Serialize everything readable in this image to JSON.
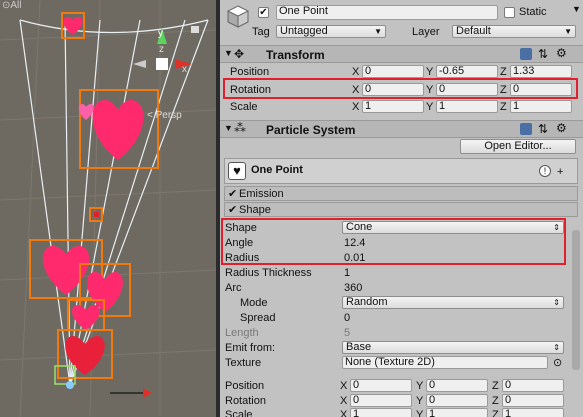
{
  "scene": {
    "search_placeholder": "All",
    "persp_label": "Persp"
  },
  "header": {
    "object_name": "One Point",
    "static_label": "Static",
    "tag_label": "Tag",
    "tag_value": "Untagged",
    "layer_label": "Layer",
    "layer_value": "Default"
  },
  "transform": {
    "title": "Transform",
    "position_label": "Position",
    "rotation_label": "Rotation",
    "scale_label": "Scale",
    "x": "X",
    "y": "Y",
    "z": "Z",
    "position": {
      "x": "0",
      "y": "-0.65",
      "z": "1.33"
    },
    "rotation": {
      "x": "0",
      "y": "0",
      "z": "0"
    },
    "scale": {
      "x": "1",
      "y": "1",
      "z": "1"
    }
  },
  "particle_system": {
    "title": "Particle System",
    "open_editor": "Open Editor...",
    "system_name": "One Point",
    "emission_label": "Emission",
    "shape_module_label": "Shape",
    "shape_label": "Shape",
    "shape_value": "Cone",
    "angle_label": "Angle",
    "angle_value": "12.4",
    "radius_label": "Radius",
    "radius_value": "0.01",
    "radius_thickness_label": "Radius Thickness",
    "radius_thickness_value": "1",
    "arc_label": "Arc",
    "arc_value": "360",
    "mode_label": "Mode",
    "mode_value": "Random",
    "spread_label": "Spread",
    "spread_value": "0",
    "length_label": "Length",
    "length_value": "5",
    "emit_from_label": "Emit from:",
    "emit_from_value": "Base",
    "texture_label": "Texture",
    "texture_value": "None (Texture 2D)",
    "position_label": "Position",
    "position": {
      "x": "0",
      "y": "0",
      "z": "0"
    },
    "rotation_label": "Rotation",
    "rotation": {
      "x": "0",
      "y": "0",
      "z": "0"
    },
    "scale_label": "Scale",
    "scale": {
      "x": "1",
      "y": "1",
      "z": "1"
    }
  },
  "colors": {
    "highlight": "#e0202a",
    "heart": "#ff2a6d",
    "selection": "#f07a10"
  }
}
